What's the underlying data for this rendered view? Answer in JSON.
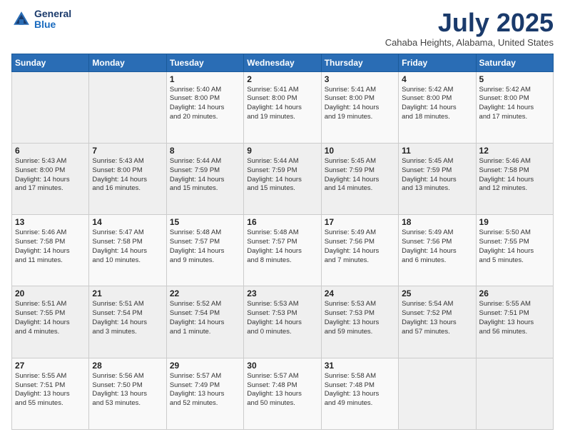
{
  "header": {
    "logo_general": "General",
    "logo_blue": "Blue",
    "month_title": "July 2025",
    "location": "Cahaba Heights, Alabama, United States"
  },
  "days_of_week": [
    "Sunday",
    "Monday",
    "Tuesday",
    "Wednesday",
    "Thursday",
    "Friday",
    "Saturday"
  ],
  "weeks": [
    [
      {
        "day": "",
        "detail": ""
      },
      {
        "day": "",
        "detail": ""
      },
      {
        "day": "1",
        "detail": "Sunrise: 5:40 AM\nSunset: 8:00 PM\nDaylight: 14 hours\nand 20 minutes."
      },
      {
        "day": "2",
        "detail": "Sunrise: 5:41 AM\nSunset: 8:00 PM\nDaylight: 14 hours\nand 19 minutes."
      },
      {
        "day": "3",
        "detail": "Sunrise: 5:41 AM\nSunset: 8:00 PM\nDaylight: 14 hours\nand 19 minutes."
      },
      {
        "day": "4",
        "detail": "Sunrise: 5:42 AM\nSunset: 8:00 PM\nDaylight: 14 hours\nand 18 minutes."
      },
      {
        "day": "5",
        "detail": "Sunrise: 5:42 AM\nSunset: 8:00 PM\nDaylight: 14 hours\nand 17 minutes."
      }
    ],
    [
      {
        "day": "6",
        "detail": "Sunrise: 5:43 AM\nSunset: 8:00 PM\nDaylight: 14 hours\nand 17 minutes."
      },
      {
        "day": "7",
        "detail": "Sunrise: 5:43 AM\nSunset: 8:00 PM\nDaylight: 14 hours\nand 16 minutes."
      },
      {
        "day": "8",
        "detail": "Sunrise: 5:44 AM\nSunset: 7:59 PM\nDaylight: 14 hours\nand 15 minutes."
      },
      {
        "day": "9",
        "detail": "Sunrise: 5:44 AM\nSunset: 7:59 PM\nDaylight: 14 hours\nand 15 minutes."
      },
      {
        "day": "10",
        "detail": "Sunrise: 5:45 AM\nSunset: 7:59 PM\nDaylight: 14 hours\nand 14 minutes."
      },
      {
        "day": "11",
        "detail": "Sunrise: 5:45 AM\nSunset: 7:59 PM\nDaylight: 14 hours\nand 13 minutes."
      },
      {
        "day": "12",
        "detail": "Sunrise: 5:46 AM\nSunset: 7:58 PM\nDaylight: 14 hours\nand 12 minutes."
      }
    ],
    [
      {
        "day": "13",
        "detail": "Sunrise: 5:46 AM\nSunset: 7:58 PM\nDaylight: 14 hours\nand 11 minutes."
      },
      {
        "day": "14",
        "detail": "Sunrise: 5:47 AM\nSunset: 7:58 PM\nDaylight: 14 hours\nand 10 minutes."
      },
      {
        "day": "15",
        "detail": "Sunrise: 5:48 AM\nSunset: 7:57 PM\nDaylight: 14 hours\nand 9 minutes."
      },
      {
        "day": "16",
        "detail": "Sunrise: 5:48 AM\nSunset: 7:57 PM\nDaylight: 14 hours\nand 8 minutes."
      },
      {
        "day": "17",
        "detail": "Sunrise: 5:49 AM\nSunset: 7:56 PM\nDaylight: 14 hours\nand 7 minutes."
      },
      {
        "day": "18",
        "detail": "Sunrise: 5:49 AM\nSunset: 7:56 PM\nDaylight: 14 hours\nand 6 minutes."
      },
      {
        "day": "19",
        "detail": "Sunrise: 5:50 AM\nSunset: 7:55 PM\nDaylight: 14 hours\nand 5 minutes."
      }
    ],
    [
      {
        "day": "20",
        "detail": "Sunrise: 5:51 AM\nSunset: 7:55 PM\nDaylight: 14 hours\nand 4 minutes."
      },
      {
        "day": "21",
        "detail": "Sunrise: 5:51 AM\nSunset: 7:54 PM\nDaylight: 14 hours\nand 3 minutes."
      },
      {
        "day": "22",
        "detail": "Sunrise: 5:52 AM\nSunset: 7:54 PM\nDaylight: 14 hours\nand 1 minute."
      },
      {
        "day": "23",
        "detail": "Sunrise: 5:53 AM\nSunset: 7:53 PM\nDaylight: 14 hours\nand 0 minutes."
      },
      {
        "day": "24",
        "detail": "Sunrise: 5:53 AM\nSunset: 7:53 PM\nDaylight: 13 hours\nand 59 minutes."
      },
      {
        "day": "25",
        "detail": "Sunrise: 5:54 AM\nSunset: 7:52 PM\nDaylight: 13 hours\nand 57 minutes."
      },
      {
        "day": "26",
        "detail": "Sunrise: 5:55 AM\nSunset: 7:51 PM\nDaylight: 13 hours\nand 56 minutes."
      }
    ],
    [
      {
        "day": "27",
        "detail": "Sunrise: 5:55 AM\nSunset: 7:51 PM\nDaylight: 13 hours\nand 55 minutes."
      },
      {
        "day": "28",
        "detail": "Sunrise: 5:56 AM\nSunset: 7:50 PM\nDaylight: 13 hours\nand 53 minutes."
      },
      {
        "day": "29",
        "detail": "Sunrise: 5:57 AM\nSunset: 7:49 PM\nDaylight: 13 hours\nand 52 minutes."
      },
      {
        "day": "30",
        "detail": "Sunrise: 5:57 AM\nSunset: 7:48 PM\nDaylight: 13 hours\nand 50 minutes."
      },
      {
        "day": "31",
        "detail": "Sunrise: 5:58 AM\nSunset: 7:48 PM\nDaylight: 13 hours\nand 49 minutes."
      },
      {
        "day": "",
        "detail": ""
      },
      {
        "day": "",
        "detail": ""
      }
    ]
  ]
}
